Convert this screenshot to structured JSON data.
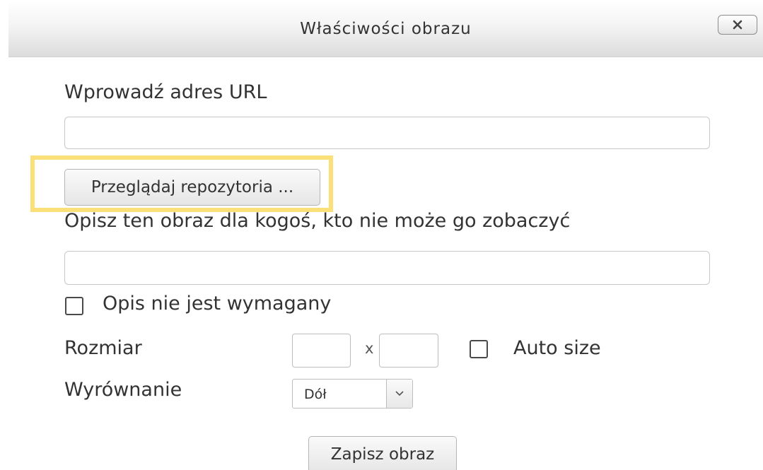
{
  "dialog": {
    "title": "Właściwości obrazu",
    "close_icon": "close-icon"
  },
  "url_section": {
    "label": "Wprowadź adres URL",
    "value": "",
    "placeholder": ""
  },
  "browse_button": {
    "label": "Przeglądaj repozytoria ...",
    "highlighted": true,
    "highlight_color": "#fbe07a"
  },
  "description_section": {
    "label": "Opisz ten obraz dla kogoś, kto nie może go zobaczyć",
    "value": "",
    "placeholder": ""
  },
  "description_not_required": {
    "label": "Opis nie jest wymagany",
    "checked": false
  },
  "size": {
    "label": "Rozmiar",
    "width_value": "",
    "height_value": "",
    "separator": "x",
    "auto_size_label": "Auto size",
    "auto_size_checked": false
  },
  "alignment": {
    "label": "Wyrównanie",
    "selected": "Dół",
    "arrow_icon": "chevron-down-icon"
  },
  "save_button": {
    "label": "Zapisz obraz"
  }
}
